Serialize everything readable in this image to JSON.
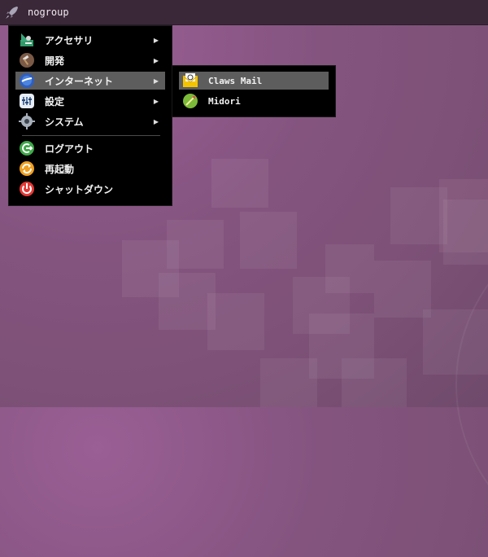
{
  "panel": {
    "user": "nogroup"
  },
  "main_menu": {
    "items": [
      {
        "label": "アクセサリ",
        "icon": "accessories-icon",
        "has_submenu": true
      },
      {
        "label": "開発",
        "icon": "development-icon",
        "has_submenu": true
      },
      {
        "label": "インターネット",
        "icon": "internet-icon",
        "has_submenu": true,
        "highlighted": true
      },
      {
        "label": "設定",
        "icon": "settings-icon",
        "has_submenu": true
      },
      {
        "label": "システム",
        "icon": "system-icon",
        "has_submenu": true
      }
    ],
    "actions": [
      {
        "label": "ログアウト",
        "icon": "logout-icon"
      },
      {
        "label": "再起動",
        "icon": "restart-icon"
      },
      {
        "label": "シャットダウン",
        "icon": "shutdown-icon"
      }
    ],
    "arrow": "▶"
  },
  "sub_menu": {
    "items": [
      {
        "label": "Claws Mail",
        "icon": "mail-icon",
        "highlighted": true
      },
      {
        "label": "Midori",
        "icon": "browser-icon"
      }
    ]
  }
}
